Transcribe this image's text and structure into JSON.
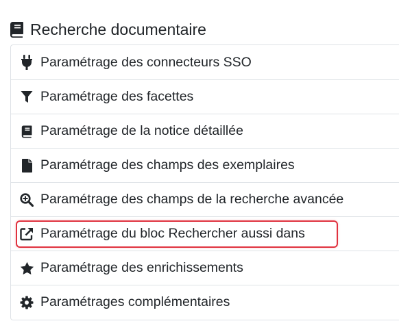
{
  "header": {
    "title": "Recherche documentaire",
    "icon": "book-icon"
  },
  "menu": {
    "items": [
      {
        "label": "Paramétrage des connecteurs SSO",
        "icon": "plug-icon"
      },
      {
        "label": "Paramétrage des facettes",
        "icon": "filter-icon"
      },
      {
        "label": "Paramétrage de la notice détaillée",
        "icon": "book-icon"
      },
      {
        "label": "Paramétrage des champs des exemplaires",
        "icon": "file-icon"
      },
      {
        "label": "Paramétrage des champs de la recherche avancée",
        "icon": "search-plus-icon"
      },
      {
        "label": "Paramétrage du bloc Rechercher aussi dans",
        "icon": "external-link-icon",
        "highlighted": true
      },
      {
        "label": "Paramétrage des enrichissements",
        "icon": "star-icon"
      },
      {
        "label": "Paramétrages complémentaires",
        "icon": "gear-icon"
      }
    ],
    "highlight_color": "#e0323f"
  }
}
